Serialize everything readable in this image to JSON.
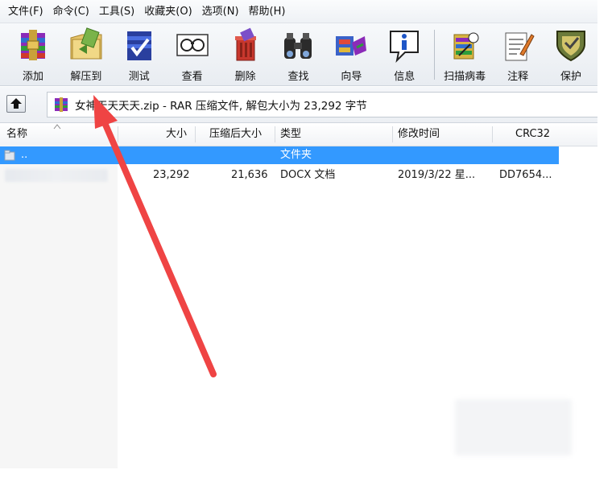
{
  "menu": [
    "文件(F)",
    "命令(C)",
    "工具(S)",
    "收藏夹(O)",
    "选项(N)",
    "帮助(H)"
  ],
  "toolbar": {
    "buttons": [
      {
        "label": "添加",
        "icon": "add-archive-icon"
      },
      {
        "label": "解压到",
        "icon": "extract-to-icon"
      },
      {
        "label": "测试",
        "icon": "test-icon"
      },
      {
        "label": "查看",
        "icon": "view-icon"
      },
      {
        "label": "删除",
        "icon": "delete-icon"
      },
      {
        "label": "查找",
        "icon": "find-icon"
      },
      {
        "label": "向导",
        "icon": "wizard-icon"
      },
      {
        "label": "信息",
        "icon": "info-icon"
      },
      {
        "label": "扫描病毒",
        "icon": "virus-scan-icon"
      },
      {
        "label": "注释",
        "icon": "comment-icon"
      },
      {
        "label": "保护",
        "icon": "protect-icon"
      }
    ]
  },
  "address": {
    "text": "女神天天天天.zip - RAR 压缩文件, 解包大小为 23,292 字节"
  },
  "columns": {
    "name": "名称",
    "size": "大小",
    "packed": "压缩后大小",
    "type": "类型",
    "modified": "修改时间",
    "crc": "CRC32"
  },
  "rows": [
    {
      "name": "..",
      "size": "",
      "packed": "",
      "type": "文件夹",
      "modified": "",
      "crc": "",
      "selected": true
    },
    {
      "name": "",
      "size": "23,292",
      "packed": "21,636",
      "type": "DOCX 文档",
      "modified": "2019/3/22 星...",
      "crc": "DD7654...",
      "selected": false
    }
  ],
  "colors": {
    "selection": "#3399ff",
    "annotation_arrow": "#ef4444"
  }
}
